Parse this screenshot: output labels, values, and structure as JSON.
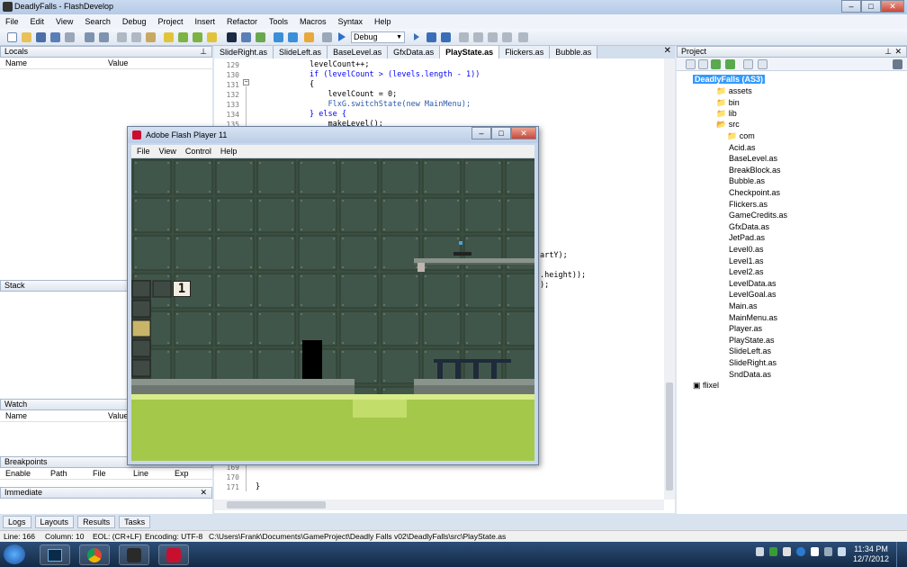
{
  "app": {
    "title": "DeadlyFalls - FlashDevelop"
  },
  "menu": [
    "File",
    "Edit",
    "View",
    "Search",
    "Debug",
    "Project",
    "Insert",
    "Refactor",
    "Tools",
    "Macros",
    "Syntax",
    "Help"
  ],
  "toolbar": {
    "config_value": "Debug"
  },
  "locals": {
    "title": "Locals",
    "col_name": "Name",
    "col_value": "Value"
  },
  "stack": {
    "title": "Stack"
  },
  "watch": {
    "title": "Watch",
    "col_name": "Name",
    "col_value": "Value"
  },
  "breakpoints": {
    "title": "Breakpoints",
    "cols": [
      "Enable",
      "Path",
      "File",
      "Line",
      "Exp"
    ]
  },
  "immediate": {
    "title": "Immediate"
  },
  "tabs": [
    "SlideRight.as",
    "SlideLeft.as",
    "BaseLevel.as",
    "GfxData.as",
    "PlayState.as",
    "Flickers.as",
    "Bubble.as"
  ],
  "active_tab": "PlayState.as",
  "code": {
    "line_numbers_top": [
      "129",
      "130",
      "131",
      "132",
      "133",
      "134",
      "135"
    ],
    "line_numbers_bottom": [
      "169",
      "170",
      "171"
    ],
    "lines": [
      "levelCount++;",
      "if (levelCount > (levels.length - 1))",
      "{",
      "    levelCount = 0;",
      "    FlxG.switchState(new MainMenu);",
      "} else {",
      "    makeLevel();"
    ],
    "fragment1": "artY);",
    "fragment2": ".height));",
    "fragment3": ");",
    "closing": "}"
  },
  "flash": {
    "title": "Adobe Flash Player 11",
    "menu": [
      "File",
      "View",
      "Control",
      "Help"
    ],
    "level_counter": "1"
  },
  "project": {
    "title": "Project",
    "root": "DeadlyFalls (AS3)",
    "folders": [
      "assets",
      "bin",
      "lib",
      "src"
    ],
    "src_children": [
      "com",
      "Acid.as",
      "BaseLevel.as",
      "BreakBlock.as",
      "Bubble.as",
      "Checkpoint.as",
      "Flickers.as",
      "GameCredits.as",
      "GfxData.as",
      "JetPad.as",
      "Level0.as",
      "Level1.as",
      "Level2.as",
      "LevelData.as",
      "LevelGoal.as",
      "Main.as",
      "MainMenu.as",
      "Player.as",
      "PlayState.as",
      "SlideLeft.as",
      "SlideRight.as",
      "SndData.as"
    ],
    "lib_root": "flixel"
  },
  "bottom_tabs": [
    "Logs",
    "Layouts",
    "Results",
    "Tasks"
  ],
  "status": {
    "line": "Line: 166",
    "column": "Column: 10",
    "eol": "EOL: (CR+LF)",
    "encoding": "Encoding: UTF-8",
    "path": "C:\\Users\\Frank\\Documents\\GameProject\\Deadly Falls v02\\DeadlyFalls\\src\\PlayState.as"
  },
  "clock": {
    "time": "11:34 PM",
    "date": "12/7/2012"
  },
  "colors": {
    "game_wall": "#3b4f40",
    "game_grass": "#a4c84a",
    "selection": "#3399ff"
  }
}
